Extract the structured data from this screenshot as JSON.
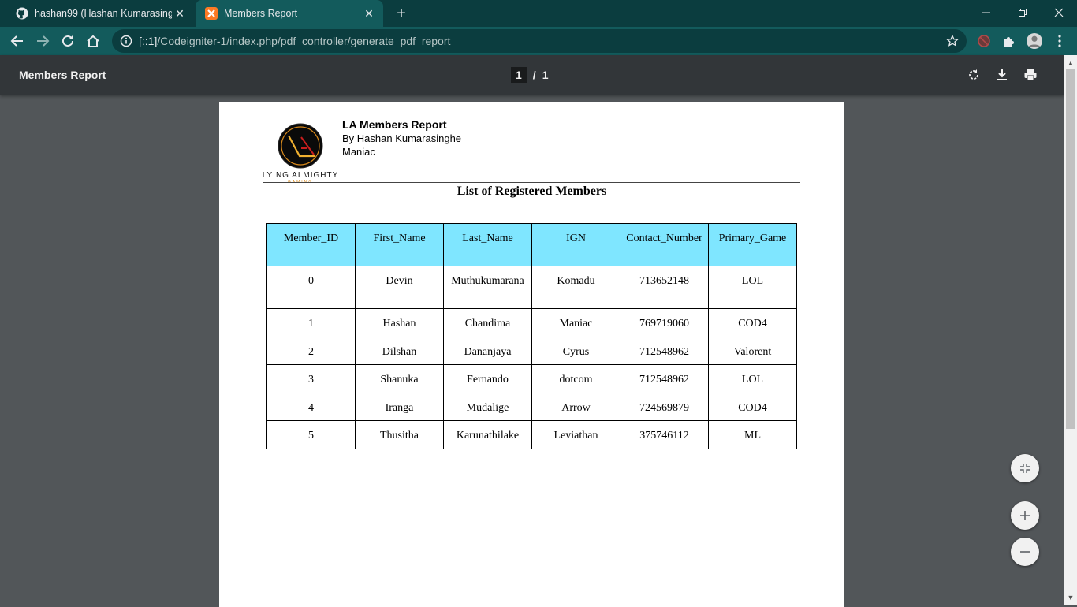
{
  "tabs": [
    {
      "title": "hashan99 (Hashan Kumarasinghe)",
      "icon": "github-icon",
      "active": false
    },
    {
      "title": "Members Report",
      "icon": "xampp-icon",
      "active": true
    }
  ],
  "address_bar": {
    "url_host": "[::1]",
    "url_path": "/Codeigniter-1/index.php/pdf_controller/generate_pdf_report"
  },
  "pdf_viewer": {
    "title": "Members Report",
    "current_page": "1",
    "page_separator": "/",
    "total_pages": "1"
  },
  "document": {
    "logo_text": "Lying Almighty",
    "logo_subtext": "GAMING",
    "heading": "LA Members Report",
    "byline": "By Hashan Kumarasinghe",
    "alias": "Maniac",
    "list_title": "List of Registered Members",
    "table": {
      "headers": [
        "Member_ID",
        "First_Name",
        "Last_Name",
        "IGN",
        "Contact_Number",
        "Primary_Game"
      ],
      "rows": [
        [
          "0",
          "Devin",
          "Muthukumarana",
          "Komadu",
          "713652148",
          "LOL"
        ],
        [
          "1",
          "Hashan",
          "Chandima",
          "Maniac",
          "769719060",
          "COD4"
        ],
        [
          "2",
          "Dilshan",
          "Dananjaya",
          "Cyrus",
          "712548962",
          "Valorent"
        ],
        [
          "3",
          "Shanuka",
          "Fernando",
          "dotcom",
          "712548962",
          "LOL"
        ],
        [
          "4",
          "Iranga",
          "Mudalige",
          "Arrow",
          "724569879",
          "COD4"
        ],
        [
          "5",
          "Thusitha",
          "Karunathilake",
          "Leviathan",
          "375746112",
          "ML"
        ]
      ]
    }
  },
  "colors": {
    "tab_strip": "#0b3d3f",
    "toolbar": "#135b5c",
    "table_header": "#7fe6ff",
    "viewer_bg": "#525659"
  }
}
